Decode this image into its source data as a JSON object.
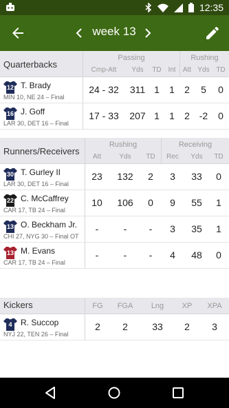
{
  "status": {
    "time": "12:35"
  },
  "header": {
    "week_title": "week 13"
  },
  "colors": {
    "appbar": "#3d6a14",
    "status": "#2f4a0f"
  },
  "quarterbacks": {
    "label": "Quarterbacks",
    "groups": {
      "passing": "Passing",
      "rushing": "Rushing"
    },
    "columns": [
      "Cmp-Att",
      "Yds",
      "TD",
      "Int",
      "Att",
      "Yds",
      "TD"
    ],
    "rows": [
      {
        "name": "T. Brady",
        "number": "12",
        "jersey_color": "#1f2d5a",
        "info": "MIN 10, NE 24 – Final",
        "stats": [
          "24 - 32",
          "311",
          "1",
          "1",
          "2",
          "5",
          "0"
        ]
      },
      {
        "name": "J. Goff",
        "number": "16",
        "jersey_color": "#1f2d5a",
        "info": "LAR 30, DET 16 – Final",
        "stats": [
          "17 - 33",
          "207",
          "1",
          "1",
          "2",
          "-2",
          "0"
        ]
      }
    ]
  },
  "runners": {
    "label": "Runners/Receivers",
    "groups": {
      "rushing": "Rushing",
      "receiving": "Receiving"
    },
    "columns": [
      "Att",
      "Yds",
      "TD",
      "Rec",
      "Yds",
      "TD"
    ],
    "rows": [
      {
        "name": "T. Gurley II",
        "number": "30",
        "jersey_color": "#1f2d5a",
        "info": "LAR 30, DET 16 – Final",
        "stats": [
          "23",
          "132",
          "2",
          "3",
          "33",
          "0"
        ]
      },
      {
        "name": "C. McCaffrey",
        "number": "22",
        "jersey_color": "#1a1a1a",
        "info": "CAR 17, TB 24 – Final",
        "stats": [
          "10",
          "106",
          "0",
          "9",
          "55",
          "1"
        ]
      },
      {
        "name": "O. Beckham Jr.",
        "number": "13",
        "jersey_color": "#1f2d5a",
        "info": "CHI 27, NYG 30 – Final OT",
        "stats": [
          "-",
          "-",
          "-",
          "3",
          "35",
          "1"
        ]
      },
      {
        "name": "M. Evans",
        "number": "13",
        "jersey_color": "#a8212f",
        "info": "CAR 17, TB 24 – Final",
        "stats": [
          "-",
          "-",
          "-",
          "4",
          "48",
          "0"
        ]
      }
    ]
  },
  "kickers": {
    "label": "Kickers",
    "columns": [
      "FG",
      "FGA",
      "Lng",
      "XP",
      "XPA"
    ],
    "rows": [
      {
        "name": "R. Succop",
        "number": "4",
        "jersey_color": "#1f2d5a",
        "info": "NYJ 22, TEN 26 – Final",
        "stats": [
          "2",
          "2",
          "33",
          "2",
          "3"
        ]
      }
    ]
  }
}
